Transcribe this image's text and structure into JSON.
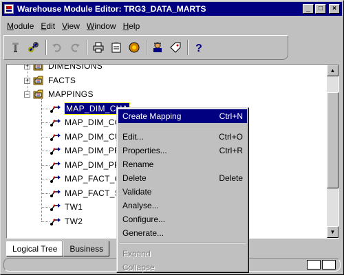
{
  "window": {
    "title": "Warehouse Module Editor: TRG3_DATA_MARTS",
    "minimize": "_",
    "maximize": "□",
    "close": "×"
  },
  "menu": [
    "Module",
    "Edit",
    "View",
    "Window",
    "Help"
  ],
  "menu_mnemonics": [
    "M",
    "E",
    "V",
    "W",
    "H"
  ],
  "toolbar": [
    "wrench-icon",
    "link-icon",
    "undo-icon",
    "redo-icon",
    "print-icon",
    "clipboard-icon",
    "deploy-icon",
    "user-icon",
    "tag-icon",
    "help-icon"
  ],
  "tree": {
    "nodes": [
      {
        "label": "DIMENSIONS",
        "type": "folder",
        "expander": "+"
      },
      {
        "label": "FACTS",
        "type": "folder",
        "expander": "+"
      },
      {
        "label": "MAPPINGS",
        "type": "folder",
        "expander": "−"
      },
      {
        "label": "MAP_DIM_CHA",
        "type": "mapping",
        "selected": true
      },
      {
        "label": "MAP_DIM_COU",
        "type": "mapping"
      },
      {
        "label": "MAP_DIM_CUS",
        "type": "mapping"
      },
      {
        "label": "MAP_DIM_PRO",
        "type": "mapping"
      },
      {
        "label": "MAP_DIM_PRO",
        "type": "mapping"
      },
      {
        "label": "MAP_FACT_CO",
        "type": "mapping"
      },
      {
        "label": "MAP_FACT_SA",
        "type": "mapping"
      },
      {
        "label": "TW1",
        "type": "mapping"
      },
      {
        "label": "TW2",
        "type": "mapping"
      }
    ]
  },
  "tabs": [
    "Logical Tree",
    "Business"
  ],
  "context_menu": {
    "items": [
      {
        "label": "Create Mapping",
        "shortcut": "Ctrl+N",
        "highlighted": true
      },
      {
        "separator": true
      },
      {
        "label": "Edit...",
        "shortcut": "Ctrl+O"
      },
      {
        "label": "Properties...",
        "shortcut": "Ctrl+R"
      },
      {
        "label": "Rename",
        "shortcut": ""
      },
      {
        "label": "Delete",
        "shortcut": "Delete"
      },
      {
        "label": "Validate",
        "shortcut": ""
      },
      {
        "label": "Analyse...",
        "shortcut": ""
      },
      {
        "label": "Configure...",
        "shortcut": ""
      },
      {
        "label": "Generate...",
        "shortcut": ""
      },
      {
        "separator": true
      },
      {
        "label": "Expand",
        "shortcut": "",
        "disabled": true
      },
      {
        "label": "Collapse",
        "shortcut": "",
        "disabled": true
      }
    ]
  },
  "colors": {
    "titlebar": "#000080",
    "selection": "#000080",
    "face": "#c0c0c0"
  }
}
